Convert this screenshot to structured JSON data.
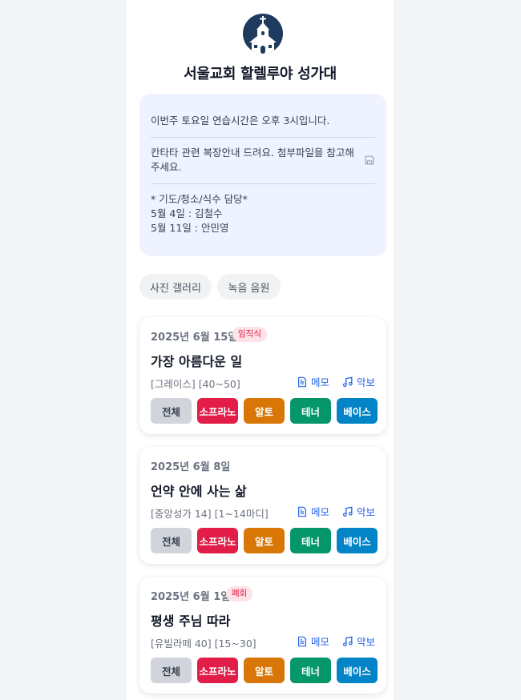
{
  "header": {
    "title": "서울교회 할렐루야 성가대",
    "logo_icon": "church-icon"
  },
  "notice": {
    "line1": "이번주 토요일 연습시간은 오후 3시입니다.",
    "line2": "칸타타 관련 복장안내 드려요. 첨부파일을 참고해 주세요.",
    "duty_title": "* 기도/청소/식수 담당*",
    "duty1": "5월 4일 : 김철수",
    "duty2": "5월 11일 : 안민영",
    "attachment_icon": "save-icon"
  },
  "chips": [
    "사진 갤러리",
    "녹음 음원"
  ],
  "link_labels": {
    "memo": "메모",
    "score": "악보"
  },
  "parts": [
    {
      "label": "전체",
      "color": "#d1d5db",
      "text": "#374151"
    },
    {
      "label": "소프라노",
      "color": "#e11d48",
      "text": "#ffffff"
    },
    {
      "label": "알토",
      "color": "#d97706",
      "text": "#ffffff"
    },
    {
      "label": "테너",
      "color": "#059669",
      "text": "#ffffff"
    },
    {
      "label": "베이스",
      "color": "#0284c7",
      "text": "#ffffff"
    }
  ],
  "cards": [
    {
      "date": "2025년 6월 15일",
      "badge": "임직식",
      "title": "가장 아름다운 일",
      "meta": "[그레이스]  [40~50]"
    },
    {
      "date": "2025년 6월 8일",
      "badge": "",
      "title": "언약 안에 사는 삶",
      "meta": "[중앙성가 14]  [1~14마디]"
    },
    {
      "date": "2025년 6월 1일",
      "badge": "폐회",
      "title": "평생 주님 따라",
      "meta": "[유빌라떼 40]  [15~30]"
    }
  ],
  "colors": {
    "accent": "#2563eb",
    "notice_bg": "#eef3ff",
    "logo_bg": "#1e3a5f"
  }
}
